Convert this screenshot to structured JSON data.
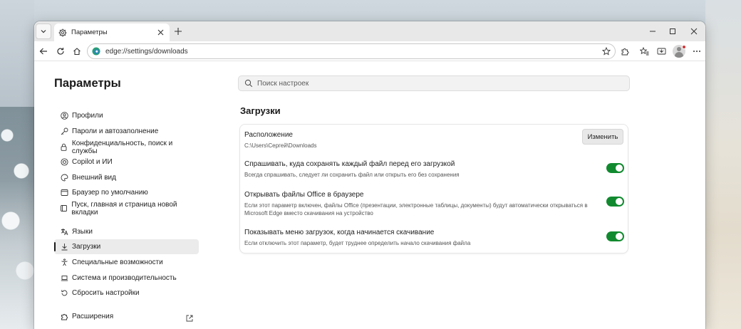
{
  "tab": {
    "title": "Параметры"
  },
  "address": {
    "url": "edge://settings/downloads"
  },
  "sidebar": {
    "title": "Параметры",
    "items": [
      {
        "label": "Профили",
        "icon": "profile-icon"
      },
      {
        "label": "Пароли и автозаполнение",
        "icon": "key-icon"
      },
      {
        "label": "Конфиденциальность, поиск и службы",
        "icon": "lock-icon"
      },
      {
        "label": "Copilot и ИИ",
        "icon": "copilot-icon"
      },
      {
        "label": "Внешний вид",
        "icon": "appearance-icon"
      },
      {
        "label": "Браузер по умолчанию",
        "icon": "browser-icon"
      },
      {
        "label": "Пуск, главная и страница новой вкладки",
        "icon": "new-tab-page-icon"
      },
      {
        "label": "Языки",
        "icon": "languages-icon"
      },
      {
        "label": "Загрузки",
        "icon": "download-icon",
        "active": true
      },
      {
        "label": "Специальные возможности",
        "icon": "accessibility-icon"
      },
      {
        "label": "Система и производительность",
        "icon": "laptop-icon"
      },
      {
        "label": "Сбросить настройки",
        "icon": "reset-icon"
      },
      {
        "label": "Расширения",
        "icon": "extensions-icon"
      }
    ]
  },
  "search": {
    "placeholder": "Поиск настроек"
  },
  "downloads": {
    "title": "Загрузки",
    "location": {
      "label": "Расположение",
      "path": "C:\\Users\\Сергей\\Downloads",
      "button": "Изменить"
    },
    "ask": {
      "label": "Спрашивать, куда сохранять каждый файл перед его загрузкой",
      "desc": "Всегда спрашивать, следует ли сохранить файл или открыть его без сохранения",
      "enabled": true
    },
    "office": {
      "label": "Открывать файлы Office в браузере",
      "desc": "Если этот параметр включен, файлы Office (презентации, электронные таблицы, документы) будут автоматически открываться в Microsoft Edge вместо скачивания на устройство",
      "enabled": true
    },
    "menu": {
      "label": "Показывать меню загрузок, когда начинается скачивание",
      "desc": "Если отключить этот параметр, будет труднее определить начало скачивания файла",
      "enabled": true
    }
  },
  "colors": {
    "toggle_on": "#118a2f",
    "accent": "#0f6cbd"
  }
}
